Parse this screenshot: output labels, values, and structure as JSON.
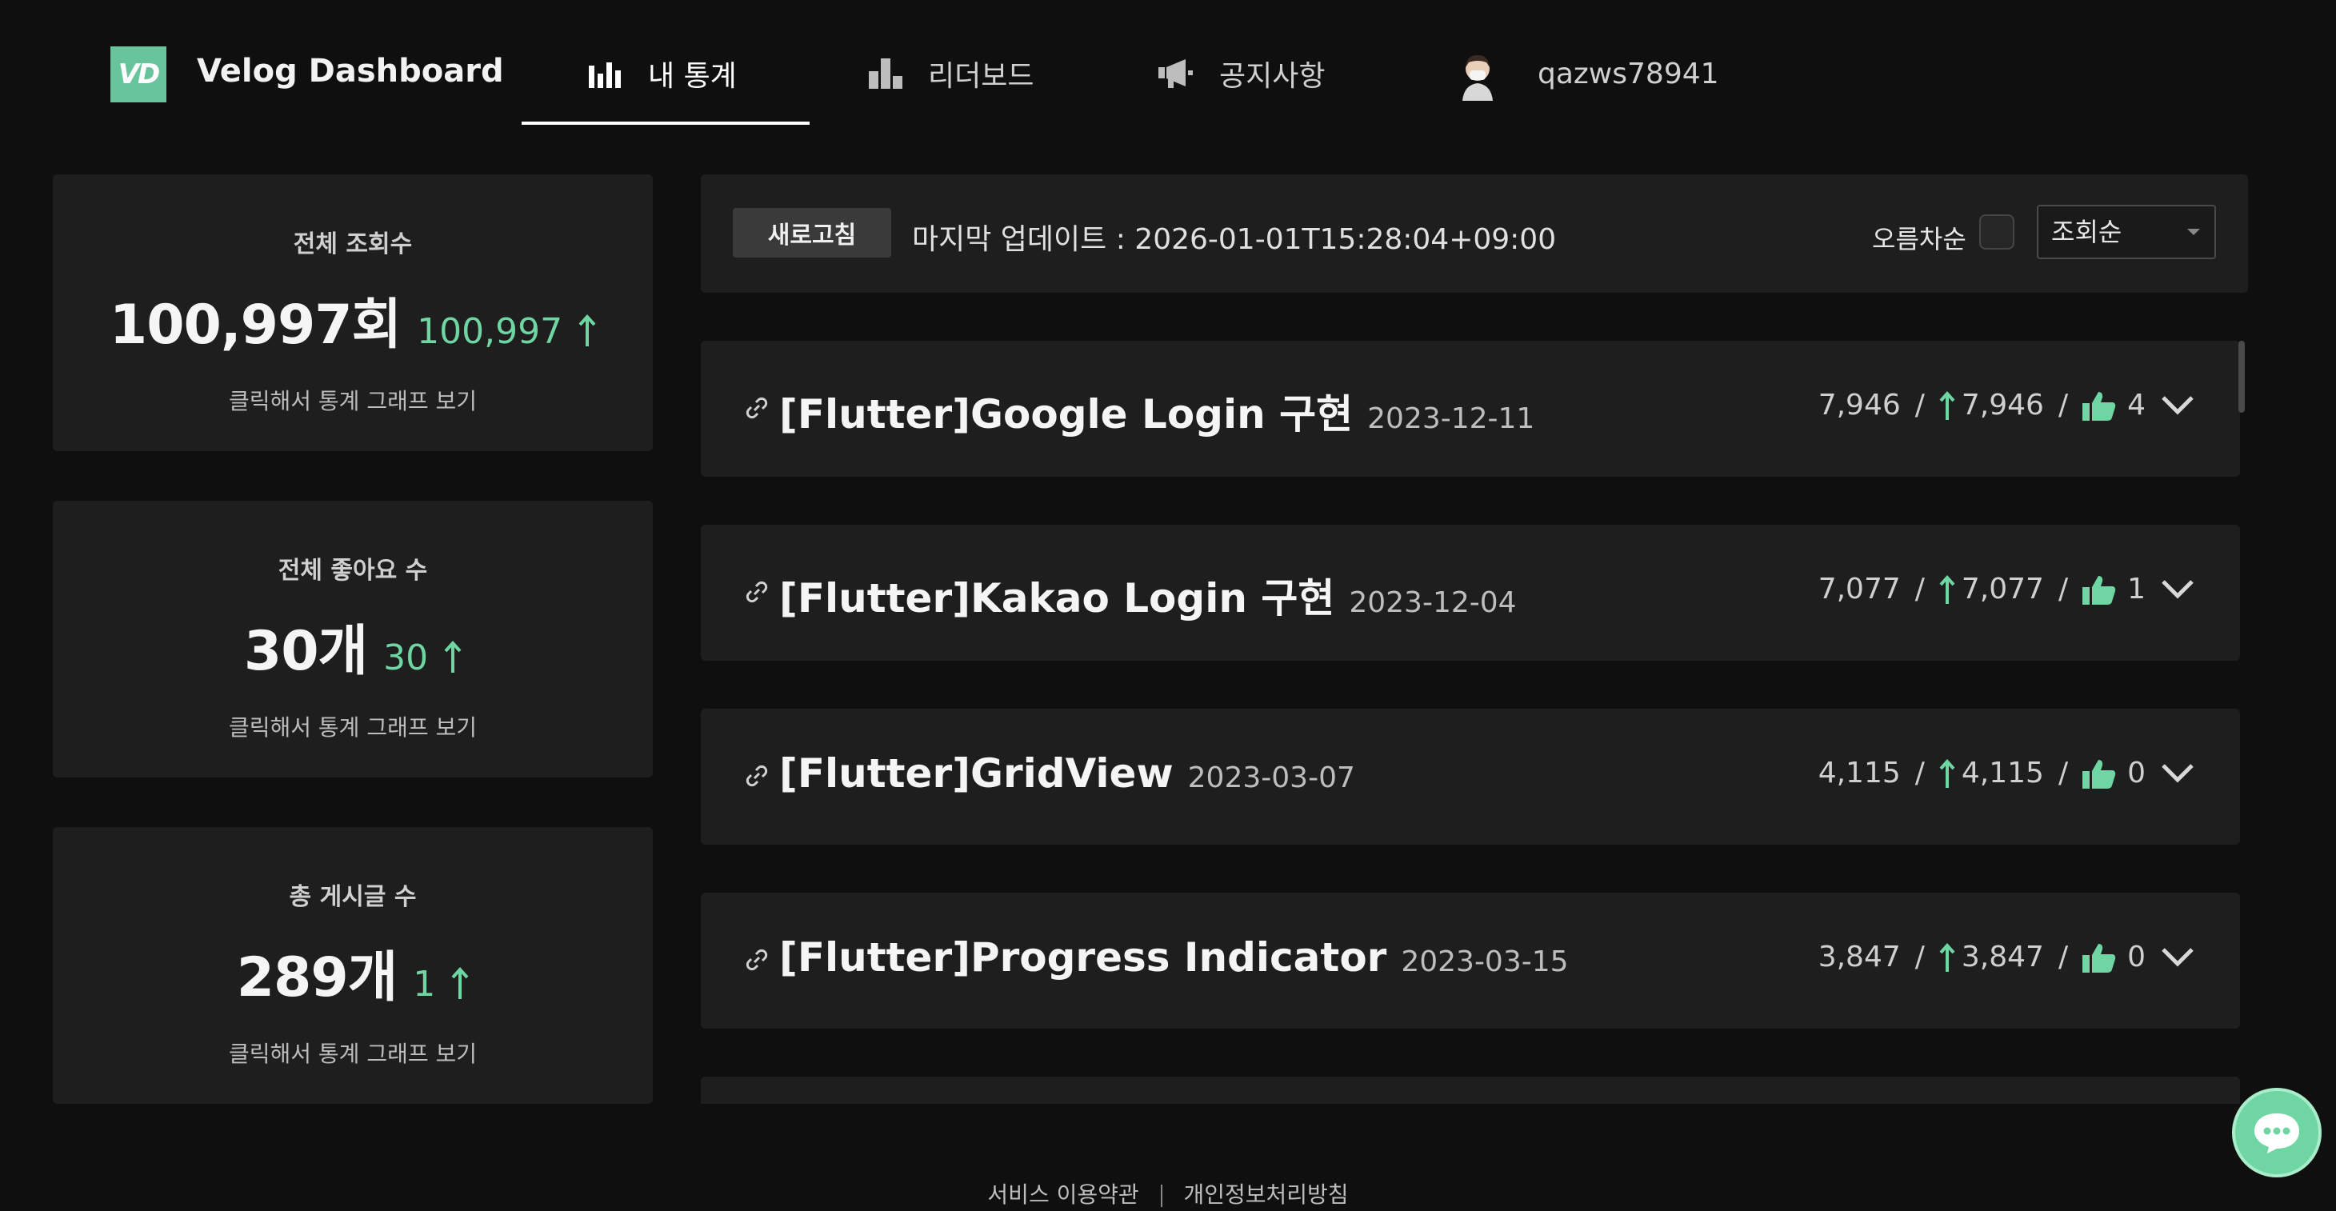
{
  "header": {
    "logo_text": "VD",
    "brand": "Velog Dashboard",
    "nav": [
      {
        "label": "내 통계",
        "icon": "bar-chart-icon",
        "active": true
      },
      {
        "label": "리더보드",
        "icon": "leaderboard-icon",
        "active": false
      },
      {
        "label": "공지사항",
        "icon": "megaphone-icon",
        "active": false
      }
    ],
    "username": "qazws78941",
    "accent_color": "#67c49b"
  },
  "stats": [
    {
      "title": "전체 조회수",
      "value": "100,997회",
      "delta": "100,997",
      "hint": "클릭해서 통계 그래프 보기"
    },
    {
      "title": "전체 좋아요 수",
      "value": "30개",
      "delta": "30",
      "hint": "클릭해서 통계 그래프 보기"
    },
    {
      "title": "총 게시글 수",
      "value": "289개",
      "delta": "1",
      "hint": "클릭해서 통계 그래프 보기"
    }
  ],
  "toolbar": {
    "refresh_label": "새로고침",
    "last_update": "마지막 업데이트 : 2026-01-01T15:28:04+09:00",
    "sort_asc_label": "오름차순",
    "sort_asc_checked": false,
    "sort_select_value": "조회순"
  },
  "posts": [
    {
      "title": "[Flutter]Google Login 구현",
      "date": "2023-12-11",
      "views": "7,946",
      "views_delta": "7,946",
      "likes": "4"
    },
    {
      "title": "[Flutter]Kakao Login 구현",
      "date": "2023-12-04",
      "views": "7,077",
      "views_delta": "7,077",
      "likes": "1"
    },
    {
      "title": "[Flutter]GridView",
      "date": "2023-03-07",
      "views": "4,115",
      "views_delta": "4,115",
      "likes": "0"
    },
    {
      "title": "[Flutter]Progress Indicator",
      "date": "2023-03-15",
      "views": "3,847",
      "views_delta": "3,847",
      "likes": "0"
    }
  ],
  "footer": {
    "terms": "서비스 이용약관",
    "privacy": "개인정보처리방침"
  },
  "colors": {
    "positive": "#6fd6a3",
    "card_bg": "#1e1e1e",
    "page_bg": "#0f0f0f"
  }
}
